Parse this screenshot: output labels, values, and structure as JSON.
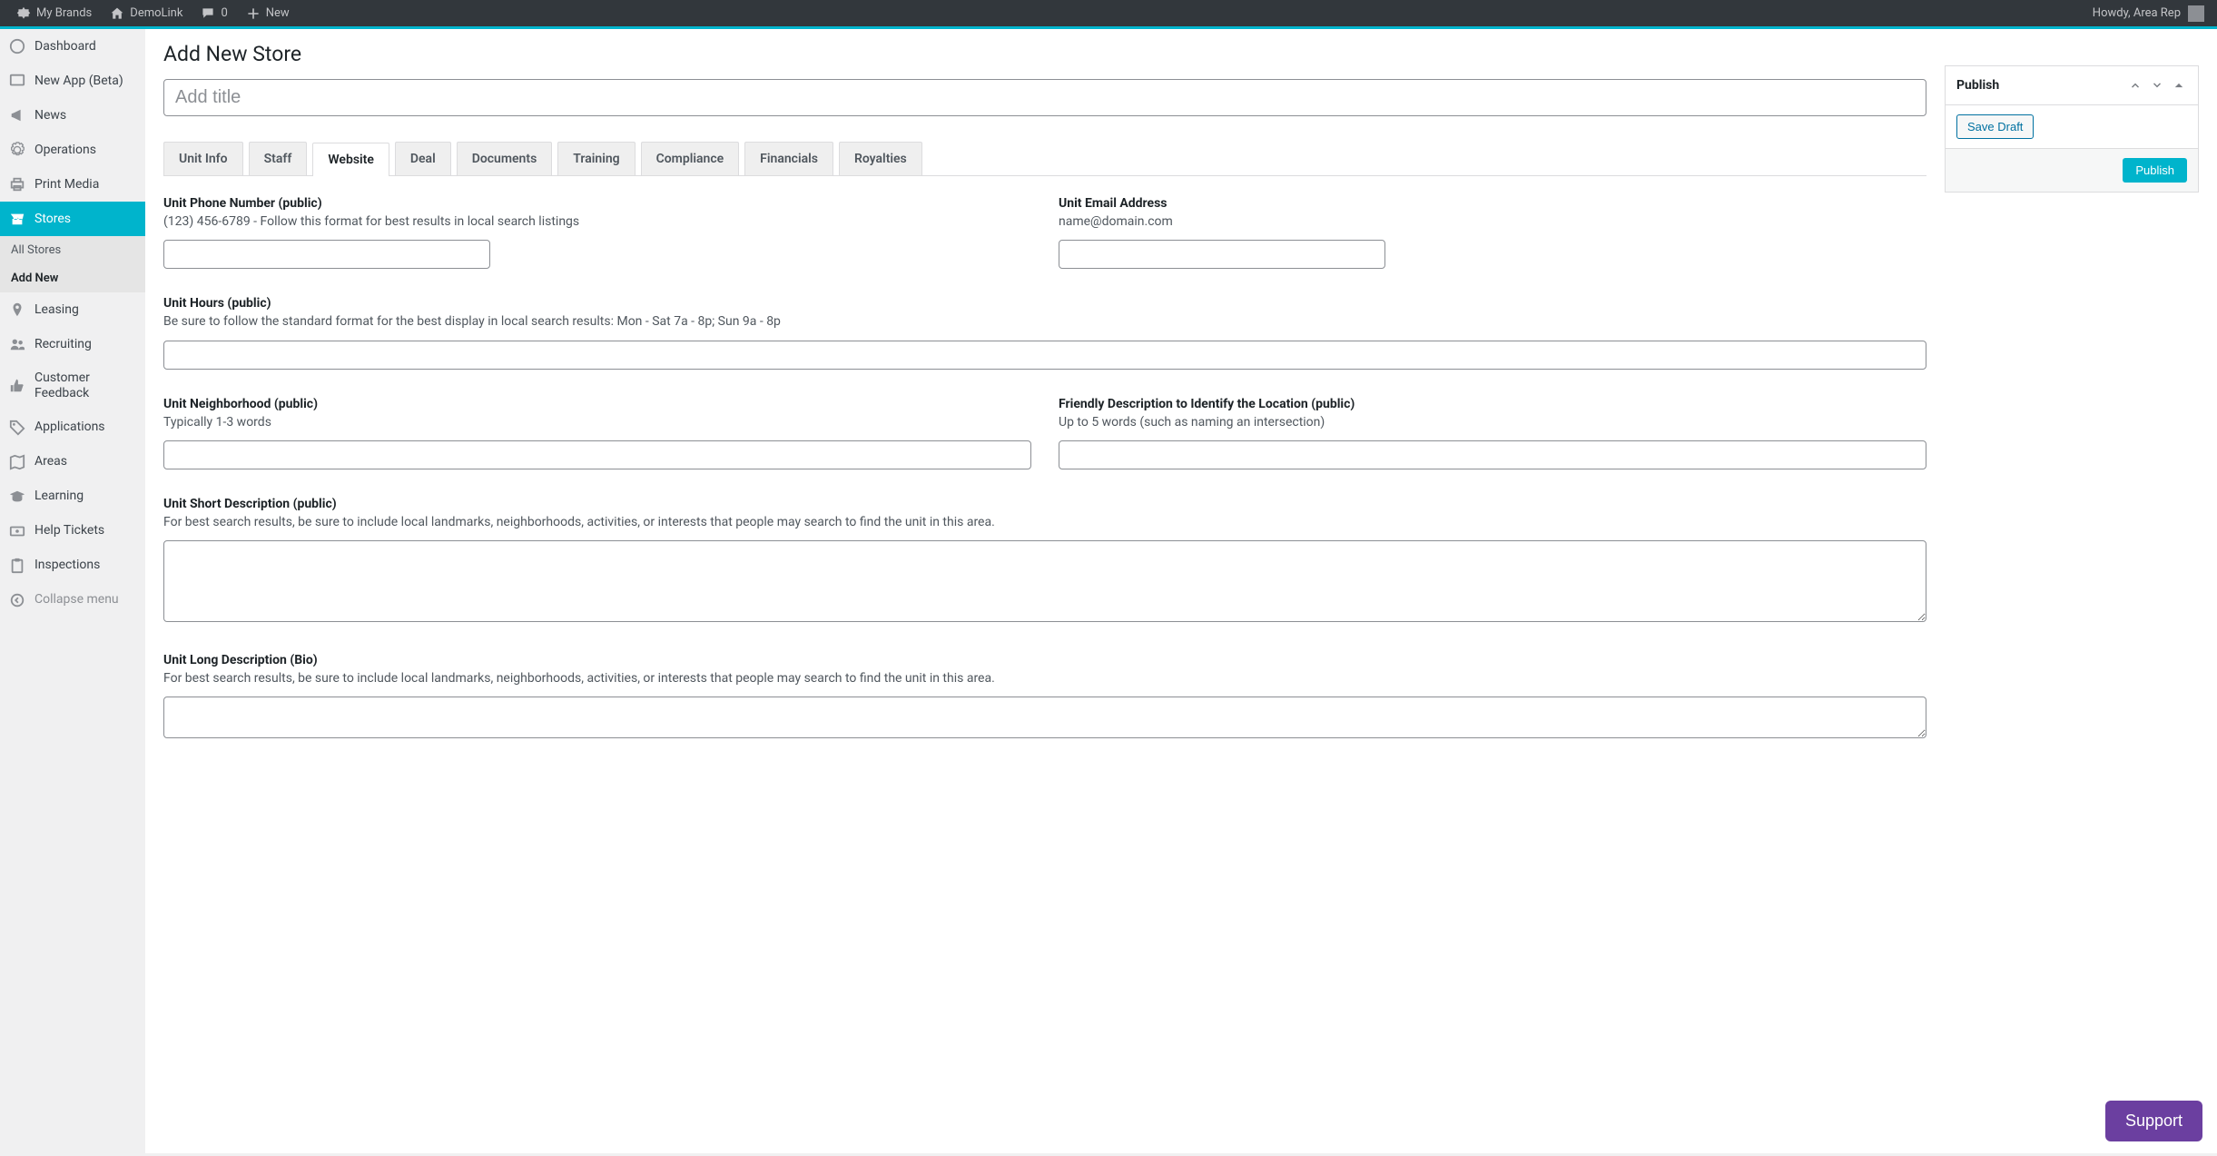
{
  "topbar": {
    "my_brands": "My Brands",
    "site_name": "DemoLink",
    "comments_count": "0",
    "new_label": "New",
    "greeting": "Howdy, Area Rep"
  },
  "sidebar": {
    "dashboard": "Dashboard",
    "new_app": "New App (Beta)",
    "news": "News",
    "operations": "Operations",
    "print_media": "Print Media",
    "stores": "Stores",
    "all_stores": "All Stores",
    "add_new": "Add New",
    "leasing": "Leasing",
    "recruiting": "Recruiting",
    "customer_feedback": "Customer Feedback",
    "applications": "Applications",
    "areas": "Areas",
    "learning": "Learning",
    "help_tickets": "Help Tickets",
    "inspections": "Inspections",
    "collapse": "Collapse menu"
  },
  "page": {
    "title": "Add New Store",
    "title_placeholder": "Add title"
  },
  "tabs": {
    "unit_info": "Unit Info",
    "staff": "Staff",
    "website": "Website",
    "deal": "Deal",
    "documents": "Documents",
    "training": "Training",
    "compliance": "Compliance",
    "financials": "Financials",
    "royalties": "Royalties"
  },
  "fields": {
    "phone": {
      "label": "Unit Phone Number (public)",
      "help": "(123) 456-6789 - Follow this format for best results in local search listings"
    },
    "email": {
      "label": "Unit Email Address",
      "help": "name@domain.com"
    },
    "hours": {
      "label": "Unit Hours (public)",
      "help": "Be sure to follow the standard format for the best display in local search results: Mon - Sat 7a - 8p; Sun 9a - 8p"
    },
    "neighborhood": {
      "label": "Unit Neighborhood (public)",
      "help": "Typically 1-3 words"
    },
    "friendly": {
      "label": "Friendly Description to Identify the Location (public)",
      "help": "Up to 5 words (such as naming an intersection)"
    },
    "short_desc": {
      "label": "Unit Short Description (public)",
      "help": "For best search results, be sure to include local landmarks, neighborhoods, activities, or interests that people may search to find the unit in this area."
    },
    "long_desc": {
      "label": "Unit Long Description (Bio)",
      "help": "For best search results, be sure to include local landmarks, neighborhoods, activities, or interests that people may search to find the unit in this area."
    }
  },
  "publish": {
    "panel_title": "Publish",
    "save_draft": "Save Draft",
    "publish_btn": "Publish"
  },
  "support": {
    "label": "Support"
  }
}
